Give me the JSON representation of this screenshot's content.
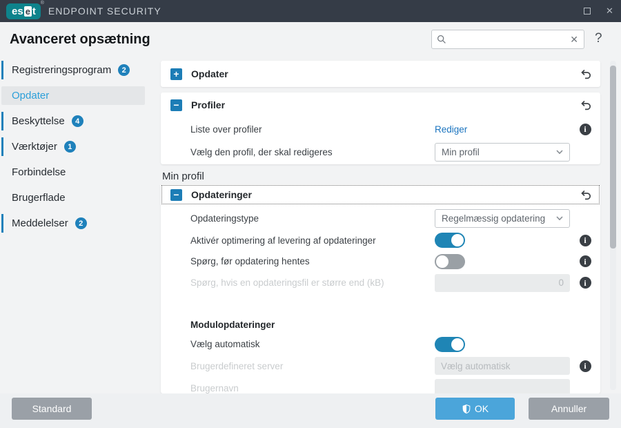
{
  "titlebar": {
    "brand_es": "es",
    "brand_e": "e",
    "brand_t": "t",
    "brand_rmark": "®",
    "product": "ENDPOINT SECURITY",
    "close_icon": "✕"
  },
  "header": {
    "title": "Avanceret opsætning",
    "search_value": "",
    "search_clear_icon": "✕",
    "help_icon": "?"
  },
  "sidebar": {
    "items": [
      {
        "label": "Registreringsprogram",
        "badge": "2"
      },
      {
        "label": "Opdater"
      },
      {
        "label": "Beskyttelse",
        "badge": "4"
      },
      {
        "label": "Værktøjer",
        "badge": "1"
      },
      {
        "label": "Forbindelse"
      },
      {
        "label": "Brugerflade"
      },
      {
        "label": "Meddelelser",
        "badge": "2"
      }
    ]
  },
  "content": {
    "opdater": {
      "title": "Opdater",
      "icon": "+"
    },
    "profiler": {
      "title": "Profiler",
      "icon": "−",
      "liste_label": "Liste over profiler",
      "rediger_link": "Rediger",
      "vaelg_label": "Vælg den profil, der skal redigeres",
      "profile_value": "Min profil"
    },
    "profile_heading": "Min profil",
    "opdateringer": {
      "title": "Opdateringer",
      "icon": "−",
      "type_label": "Opdateringstype",
      "type_value": "Regelmæssig opdatering",
      "optimering_label": "Aktivér optimering af levering af opdateringer",
      "optimering_state": "on",
      "sporg_label": "Spørg, før opdatering hentes",
      "sporg_state": "off",
      "kb_label": "Spørg, hvis en opdateringsfil er større end (kB)",
      "kb_value": "0",
      "modul_heading": "Modulopdateringer",
      "auto_label": "Vælg automatisk",
      "auto_state": "on",
      "server_label": "Brugerdefineret server",
      "server_placeholder": "Vælg automatisk",
      "brugernavn_label": "Brugernavn"
    }
  },
  "footer": {
    "standard": "Standard",
    "ok": "OK",
    "annuller": "Annuller"
  },
  "colors": {
    "brand_teal": "#0e838c",
    "titlebar_bg": "#353c47",
    "accent_blue": "#1f81bb",
    "selected_text": "#2b9fd9",
    "toggle_on": "#1f85b5",
    "ok_button": "#4ba5da",
    "gray_button": "#9aa0a7",
    "link_blue": "#1b74bf"
  }
}
